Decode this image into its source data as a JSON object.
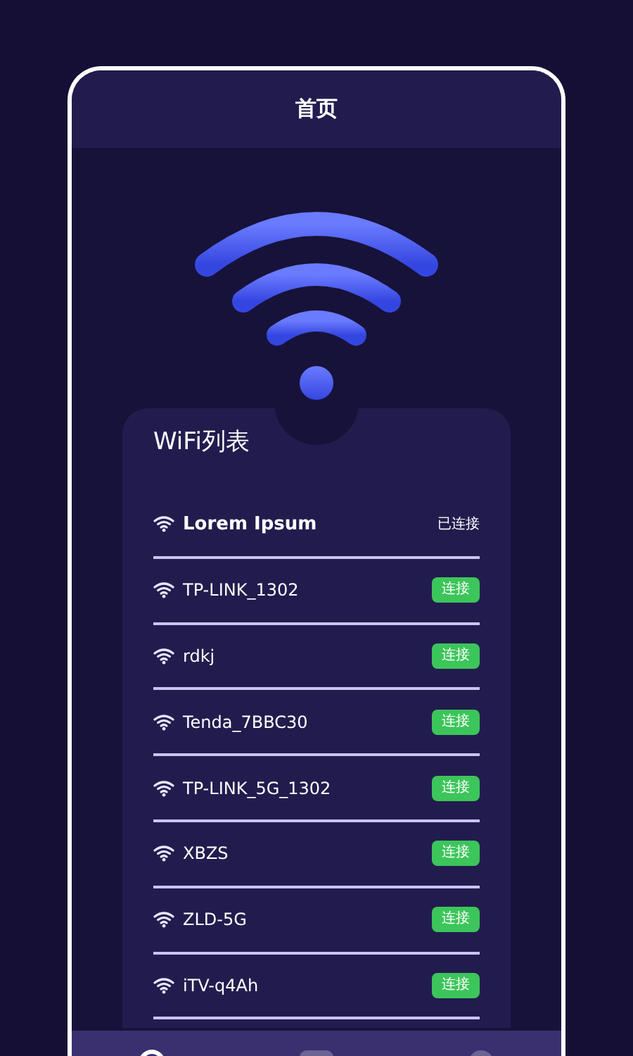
{
  "header": {
    "title": "首页"
  },
  "wifi_list": {
    "title": "WiFi列表",
    "networks": [
      {
        "name": "Lorem Ipsum",
        "connected": true,
        "status": "已连接"
      },
      {
        "name": "TP-LINK_1302",
        "connected": false,
        "action": "连接"
      },
      {
        "name": "rdkj",
        "connected": false,
        "action": "连接"
      },
      {
        "name": "Tenda_7BBC30",
        "connected": false,
        "action": "连接"
      },
      {
        "name": "TP-LINK_5G_1302",
        "connected": false,
        "action": "连接"
      },
      {
        "name": "XBZS",
        "connected": false,
        "action": "连接"
      },
      {
        "name": "ZLD-5G",
        "connected": false,
        "action": "连接"
      },
      {
        "name": "iTV-q4Ah",
        "connected": false,
        "action": "连接"
      }
    ]
  },
  "bottom_nav": {
    "items": [
      {
        "selected": true
      },
      {
        "selected": false
      },
      {
        "selected": false
      }
    ]
  }
}
